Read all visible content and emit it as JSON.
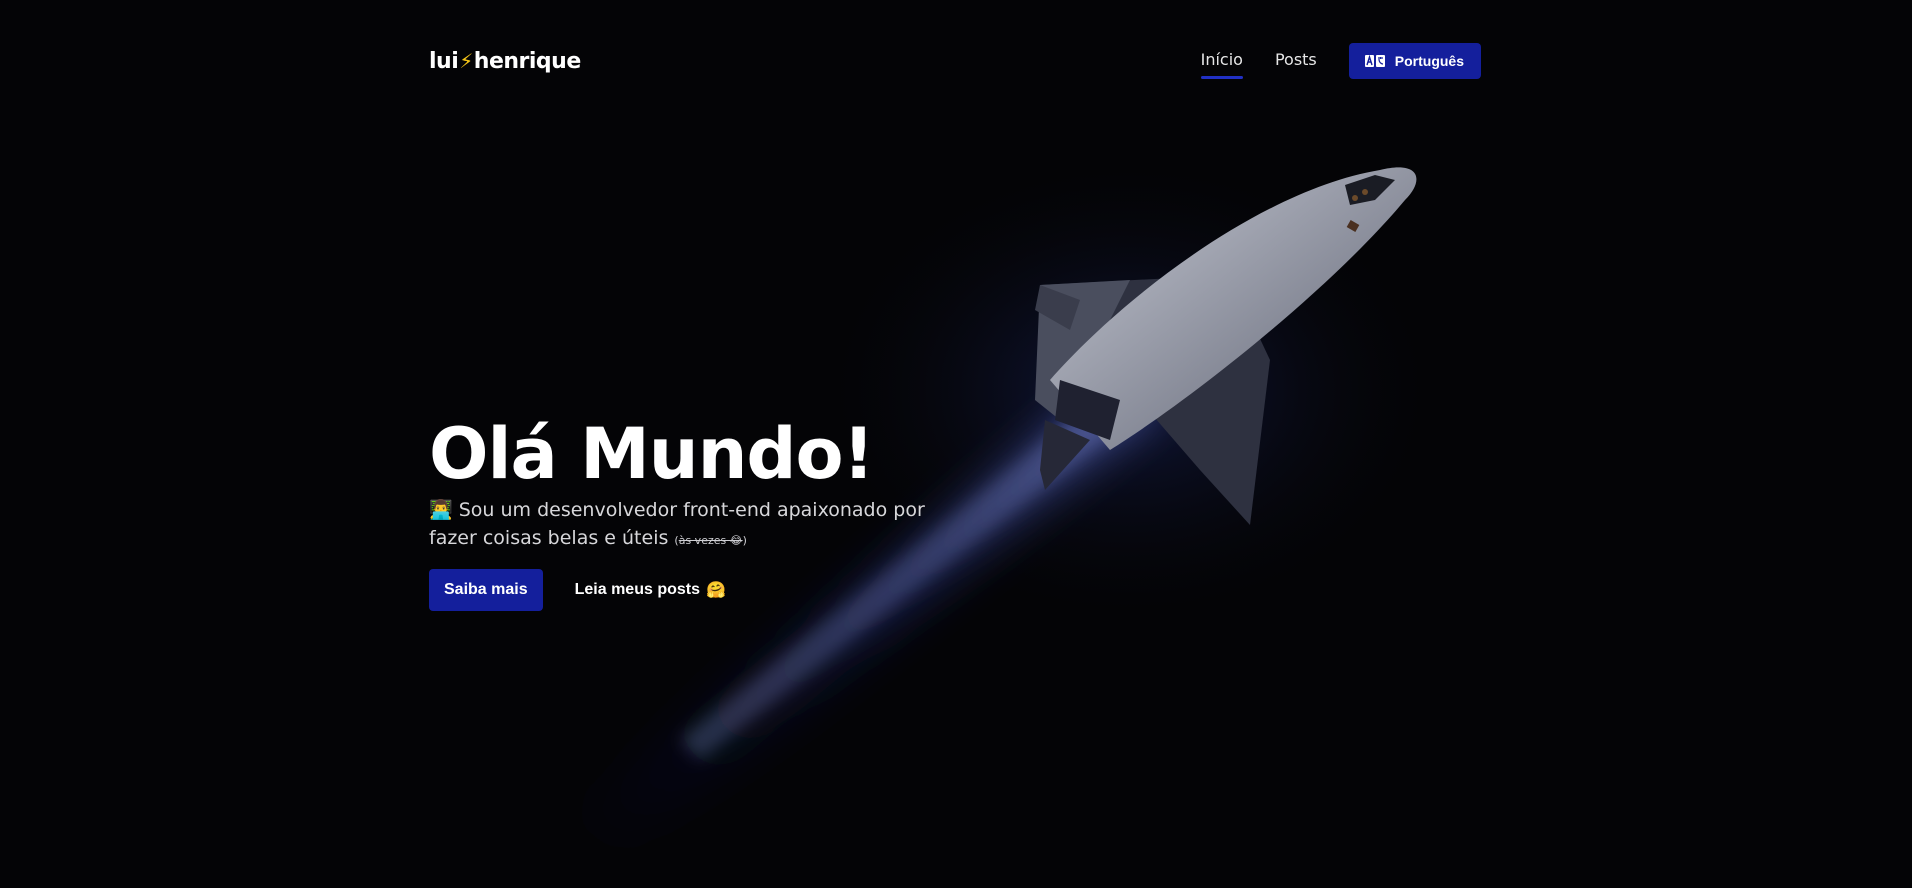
{
  "header": {
    "logo_left": "lui",
    "logo_bolt": "⚡",
    "logo_right": "henrique",
    "nav": [
      {
        "label": "Início",
        "active": true
      },
      {
        "label": "Posts",
        "active": false
      }
    ],
    "language_button": {
      "label": "Português",
      "icon": "translate-icon"
    }
  },
  "hero": {
    "title": "Olá Mundo!",
    "subtitle_emoji": "👨‍💻",
    "subtitle_text": "Sou um desenvolvedor front-end apaixonado por fazer coisas belas e úteis",
    "subtitle_note": "às vezes 😂",
    "primary_button": "Saiba mais",
    "secondary_button": "Leia meus posts",
    "secondary_emoji": "🤗"
  },
  "colors": {
    "background": "#040406",
    "accent": "#141f9c",
    "bolt": "#f5c518"
  }
}
